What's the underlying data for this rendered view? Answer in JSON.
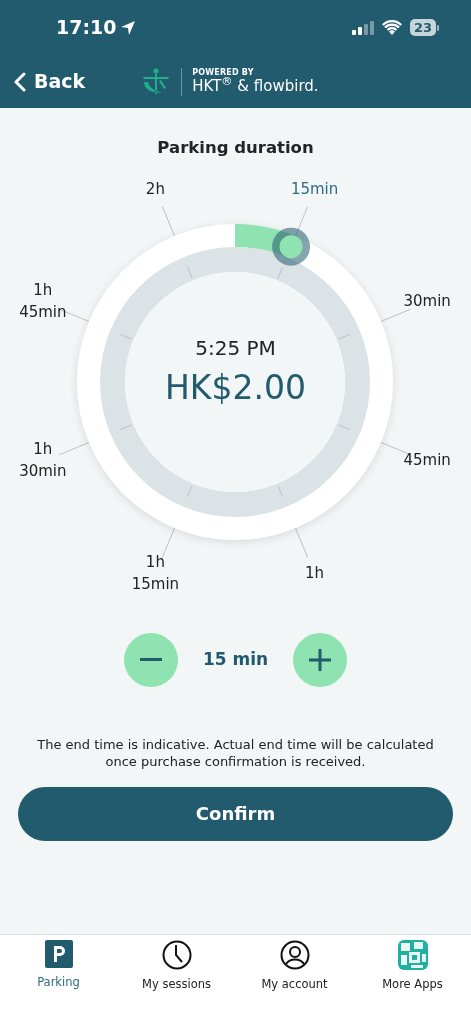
{
  "status_bar": {
    "time": "17:10",
    "battery": "23"
  },
  "nav": {
    "back": "Back",
    "powered_by": "POWERED BY",
    "brand": "HKT$^{®}$ & flowbird."
  },
  "title": "Parking duration",
  "dial": {
    "end_time": "5:25 PM",
    "price": "HK$2.00",
    "labels": [
      {
        "text": "2h",
        "selected": false
      },
      {
        "text": "15min",
        "selected": true
      },
      {
        "text": "1h 45min",
        "selected": false
      },
      {
        "text": "30min",
        "selected": false
      },
      {
        "text": "1h 30min",
        "selected": false
      },
      {
        "text": "45min",
        "selected": false
      },
      {
        "text": "1h 15min",
        "selected": false
      },
      {
        "text": "1h",
        "selected": false
      }
    ]
  },
  "stepper": {
    "value": "15 min"
  },
  "note": "The end time is indicative. Actual end time will be calculated once purchase confirmation is received.",
  "confirm": "Confirm",
  "tabs": [
    {
      "label": "Parking",
      "kind": "parking",
      "selected": true
    },
    {
      "label": "My sessions",
      "kind": "clock",
      "selected": false
    },
    {
      "label": "My account",
      "kind": "person",
      "selected": false
    },
    {
      "label": "More Apps",
      "kind": "apps",
      "selected": false
    }
  ]
}
